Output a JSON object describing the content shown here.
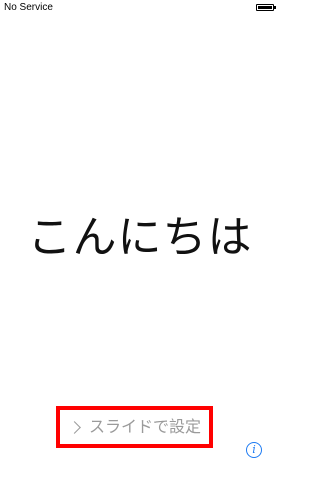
{
  "status_bar": {
    "carrier": "No Service",
    "battery_icon": "battery-icon"
  },
  "main": {
    "greeting": "こんにちは"
  },
  "footer": {
    "slide_label": "スライドで設定",
    "chevron_icon": "chevron-right-icon",
    "info_icon": "info-icon",
    "info_glyph": "i",
    "highlight_color": "#ff0000",
    "accent_color": "#1e7bf2"
  }
}
